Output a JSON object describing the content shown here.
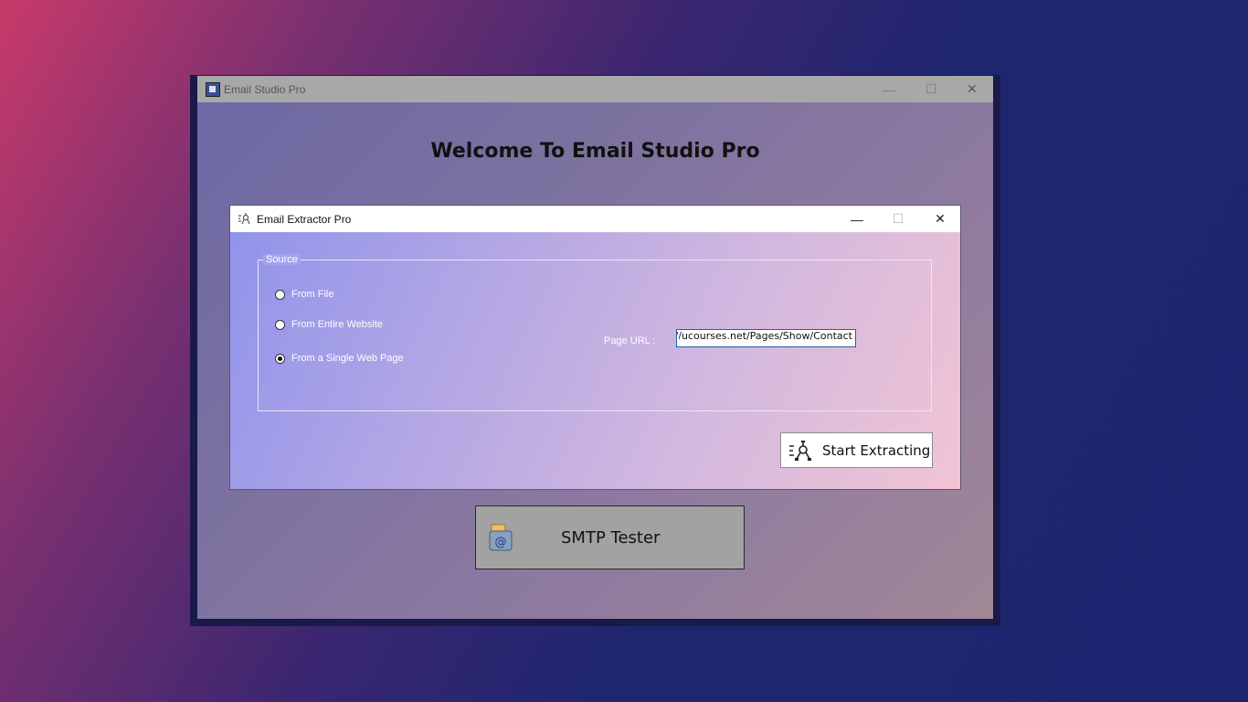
{
  "outer_window": {
    "title": "Email Studio Pro",
    "controls": {
      "minimize": "—",
      "maximize": "☐",
      "close": "✕"
    }
  },
  "welcome_heading": "Welcome To Email Studio Pro",
  "inner_window": {
    "title": "Email Extractor Pro",
    "controls": {
      "minimize": "—",
      "maximize": "☐",
      "close": "✕"
    },
    "source_group": {
      "legend": "Source",
      "options": [
        {
          "label": "From File",
          "selected": false
        },
        {
          "label": "From Entire Website",
          "selected": false
        },
        {
          "label": "From a Single Web Page",
          "selected": true
        }
      ]
    },
    "page_url": {
      "label": "Page URL :",
      "value": "://ucourses.net/Pages/Show/Contact"
    },
    "start_button": {
      "label": "Start Extracting",
      "icon": "extract-icon"
    }
  },
  "smtp_button": {
    "label": "SMTP Tester",
    "icon": "mail-at-icon"
  }
}
